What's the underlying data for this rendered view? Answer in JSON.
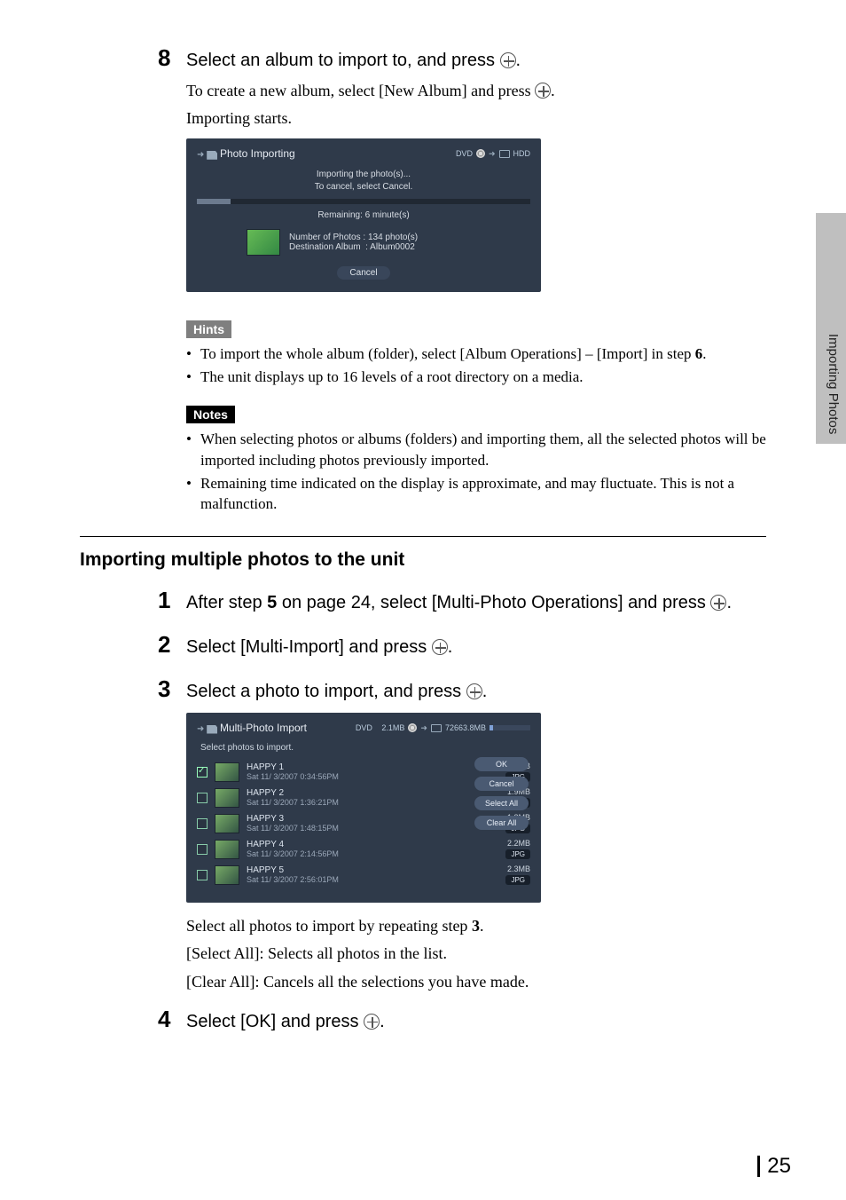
{
  "side_tab": "Importing Photos",
  "step8": {
    "num": "8",
    "title_a": "Select an album to import to, and press ",
    "title_b": ".",
    "body_a": "To create a new album, select [New Album] and press ",
    "body_b": ".",
    "body_c": "Importing starts."
  },
  "panel1": {
    "title": "Photo Importing",
    "status_left": "DVD",
    "status_right": "HDD",
    "msg1": "Importing the photo(s)...",
    "msg2": "To cancel, select Cancel.",
    "remaining": "Remaining: 6 minute(s)",
    "num_photos_label": "Number of Photos",
    "num_photos_value": ": 134 photo(s)",
    "dest_label": "Destination Album",
    "dest_value": ": Album0002",
    "cancel": "Cancel"
  },
  "hints_label": "Hints",
  "hints": [
    "To import the whole album (folder), select [Album Operations] – [Import] in step 6.",
    "The unit displays up to 16 levels of a root directory on a media."
  ],
  "notes_label": "Notes",
  "notes": [
    "When selecting photos or albums (folders) and importing them, all the selected photos will be imported including photos previously imported.",
    "Remaining time indicated on the display is approximate, and may fluctuate. This is not a malfunction."
  ],
  "section_title": "Importing multiple photos to the unit",
  "step1": {
    "num": "1",
    "text_a": "After step ",
    "five": "5",
    "text_b": " on page 24, select [Multi-Photo Operations] and press ",
    "text_c": "."
  },
  "step2": {
    "num": "2",
    "text_a": "Select [Multi-Import] and press ",
    "text_b": "."
  },
  "step3": {
    "num": "3",
    "text_a": "Select a photo to import, and press ",
    "text_b": "."
  },
  "panel2": {
    "title": "Multi-Photo Import",
    "src": "DVD",
    "cur_size": "2.1MB",
    "free": "72663.8MB",
    "subtitle": "Select photos to import.",
    "items": [
      {
        "checked": true,
        "name": "HAPPY 1",
        "date": "Sat 11/ 3/2007  0:34:56PM",
        "size": "2.1MB",
        "tag": "JPG"
      },
      {
        "checked": false,
        "name": "HAPPY 2",
        "date": "Sat 11/ 3/2007  1:36:21PM",
        "size": "1.9MB",
        "tag": "JPG"
      },
      {
        "checked": false,
        "name": "HAPPY 3",
        "date": "Sat 11/ 3/2007  1:48:15PM",
        "size": "1.8MB",
        "tag": "JPG"
      },
      {
        "checked": false,
        "name": "HAPPY 4",
        "date": "Sat 11/ 3/2007  2:14:56PM",
        "size": "2.2MB",
        "tag": "JPG"
      },
      {
        "checked": false,
        "name": "HAPPY 5",
        "date": "Sat 11/ 3/2007  2:56:01PM",
        "size": "2.3MB",
        "tag": "JPG"
      }
    ],
    "btn_ok": "OK",
    "btn_cancel": "Cancel",
    "btn_select_all": "Select All",
    "btn_clear_all": "Clear All"
  },
  "after_step3": {
    "l1_a": "Select all photos to import by repeating step ",
    "l1_b": "3",
    "l1_c": ".",
    "l2": "[Select All]: Selects all photos in the list.",
    "l3": "[Clear All]: Cancels all the selections you have made."
  },
  "step4": {
    "num": "4",
    "text_a": "Select [OK] and press ",
    "text_b": "."
  },
  "page_number": "25"
}
